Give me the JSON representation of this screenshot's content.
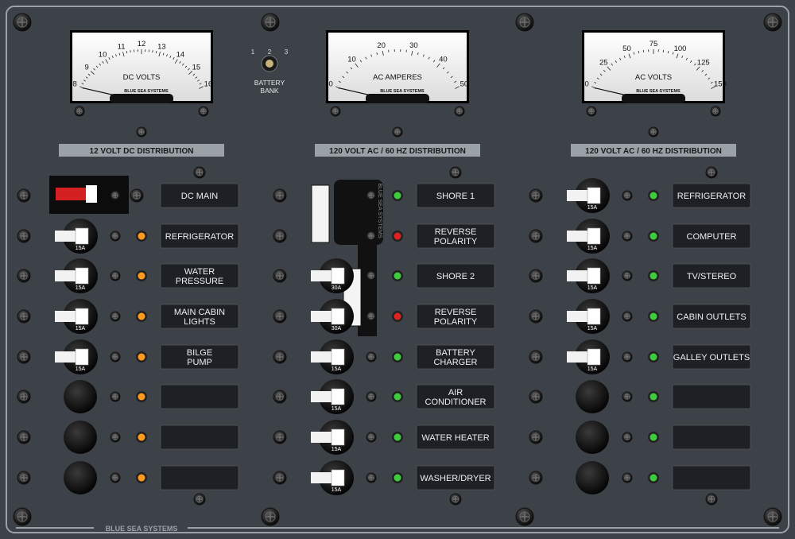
{
  "brand": "BLUE SEA SYSTEMS",
  "colors": {
    "panel": "#3c4247",
    "trim": "#9aa2a8",
    "label_bg": "#1d2125",
    "led_amber": "#ff9a1f",
    "led_green": "#3ecc3e",
    "led_red": "#e02222",
    "breaker_white": "#f2f2f2"
  },
  "meters": [
    {
      "label": "DC VOLTS",
      "brand": "BLUE SEA SYSTEMS",
      "ticks": [
        "8",
        "9",
        "10",
        "11",
        "12",
        "13",
        "14",
        "15",
        "16"
      ],
      "reading": "8"
    },
    {
      "label": "AC AMPERES",
      "brand": "BLUE SEA SYSTEMS",
      "ticks": [
        "0",
        "10",
        "20",
        "30",
        "40",
        "50"
      ],
      "reading": "0"
    },
    {
      "label": "AC VOLTS",
      "brand": "BLUE SEA SYSTEMS",
      "ticks": [
        "0",
        "25",
        "50",
        "75",
        "100",
        "125",
        "150"
      ],
      "reading": "0"
    }
  ],
  "battery_selector": {
    "label": [
      "BATTERY",
      "BANK"
    ],
    "positions": [
      "1",
      "2",
      "3"
    ]
  },
  "sections": [
    {
      "title": "12 VOLT DC DISTRIBUTION"
    },
    {
      "title": "120 VOLT AC / 60 HZ DISTRIBUTION"
    },
    {
      "title": "120 VOLT AC / 60 HZ DISTRIBUTION"
    }
  ],
  "columns": [
    {
      "led_color": "amber",
      "circuits": [
        {
          "label": [
            "DC MAIN"
          ],
          "breaker": "main",
          "led": false
        },
        {
          "label": [
            "REFRIGERATOR"
          ],
          "breaker": "15A",
          "led": true
        },
        {
          "label": [
            "WATER",
            "PRESSURE"
          ],
          "breaker": "15A",
          "led": true
        },
        {
          "label": [
            "MAIN CABIN",
            "LIGHTS"
          ],
          "breaker": "15A",
          "led": true
        },
        {
          "label": [
            "BILGE",
            "PUMP"
          ],
          "breaker": "15A",
          "led": true
        },
        {
          "label": [],
          "breaker": "blank",
          "led": true
        },
        {
          "label": [],
          "breaker": "blank",
          "led": true
        },
        {
          "label": [],
          "breaker": "blank",
          "led": true
        }
      ]
    },
    {
      "led_color": "green",
      "circuits": [
        {
          "label": [
            "SHORE 1"
          ],
          "breaker": "interlock",
          "led": "green"
        },
        {
          "label": [
            "REVERSE",
            "POLARITY"
          ],
          "breaker": "interlock",
          "led": "red"
        },
        {
          "label": [
            "SHORE 2"
          ],
          "breaker": "30A",
          "led": "green"
        },
        {
          "label": [
            "REVERSE",
            "POLARITY"
          ],
          "breaker": "30A",
          "led": "red"
        },
        {
          "label": [
            "BATTERY",
            "CHARGER"
          ],
          "breaker": "15A",
          "led": "green"
        },
        {
          "label": [
            "AIR",
            "CONDITIONER"
          ],
          "breaker": "15A",
          "led": "green"
        },
        {
          "label": [
            "WATER HEATER"
          ],
          "breaker": "15A",
          "led": "green"
        },
        {
          "label": [
            "WASHER/DRYER"
          ],
          "breaker": "15A",
          "led": "green"
        }
      ]
    },
    {
      "led_color": "green",
      "circuits": [
        {
          "label": [
            "REFRIGERATOR"
          ],
          "breaker": "15A",
          "led": "green"
        },
        {
          "label": [
            "COMPUTER"
          ],
          "breaker": "15A",
          "led": "green"
        },
        {
          "label": [
            "TV/STEREO"
          ],
          "breaker": "15A",
          "led": "green"
        },
        {
          "label": [
            "CABIN OUTLETS"
          ],
          "breaker": "15A",
          "led": "green"
        },
        {
          "label": [
            "GALLEY OUTLETS"
          ],
          "breaker": "15A",
          "led": "green"
        },
        {
          "label": [],
          "breaker": "blank",
          "led": "green"
        },
        {
          "label": [],
          "breaker": "blank",
          "led": "green"
        },
        {
          "label": [],
          "breaker": "blank",
          "led": "green"
        }
      ]
    }
  ],
  "interlock_text": "BLUE SEA SYSTEMS"
}
